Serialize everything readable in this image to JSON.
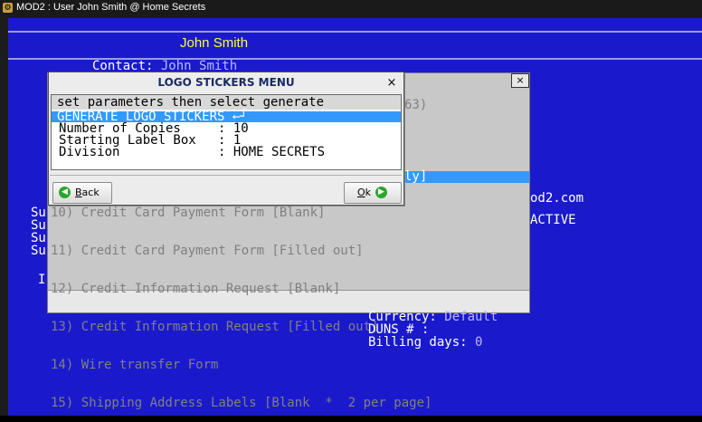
{
  "window": {
    "title": "MOD2 : User John Smith @ Home Secrets",
    "app_icon": "⚙"
  },
  "header": {
    "user_name": "John Smith"
  },
  "contact": {
    "label": "Contact:",
    "value": "John Smith"
  },
  "background": {
    "phone_fragment": "63)",
    "highlight_fragment": "ly]",
    "website_fragment": "od2.com",
    "status_fragment": "ACTIVE",
    "su_labels": [
      "Su",
      "Su",
      "Su",
      "Su"
    ],
    "i_label": "I",
    "currency_label": "Currency:",
    "currency_value": "Default",
    "duns_label": "DUNS # :",
    "billing_label": "Billing days:",
    "billing_value": "0"
  },
  "back_dialog": {
    "close_glyph": "×",
    "items": [
      "10) Credit Card Payment Form [Blank]",
      "11) Credit Card Payment Form [Filled out]",
      "12) Credit Information Request [Blank]",
      "13) Credit Information Request [Filled out]",
      "14) Wire transfer Form",
      "15) Shipping Address Labels [Blank  *  2 per page]"
    ]
  },
  "dialog": {
    "title": "LOGO STICKERS MENU",
    "close_glyph": "×",
    "header_text": "set parameters then select generate",
    "selected_item": "GENERATE LOGO STICKERS ←┘",
    "params": [
      {
        "label": "Number of Copies",
        "value": "10"
      },
      {
        "label": "Starting Label Box",
        "value": "1"
      },
      {
        "label": "Division",
        "value": "HOME SECRETS"
      }
    ],
    "back_button": "Back",
    "ok_button": "Ok",
    "back_icon": "◀",
    "ok_icon": "▶"
  }
}
